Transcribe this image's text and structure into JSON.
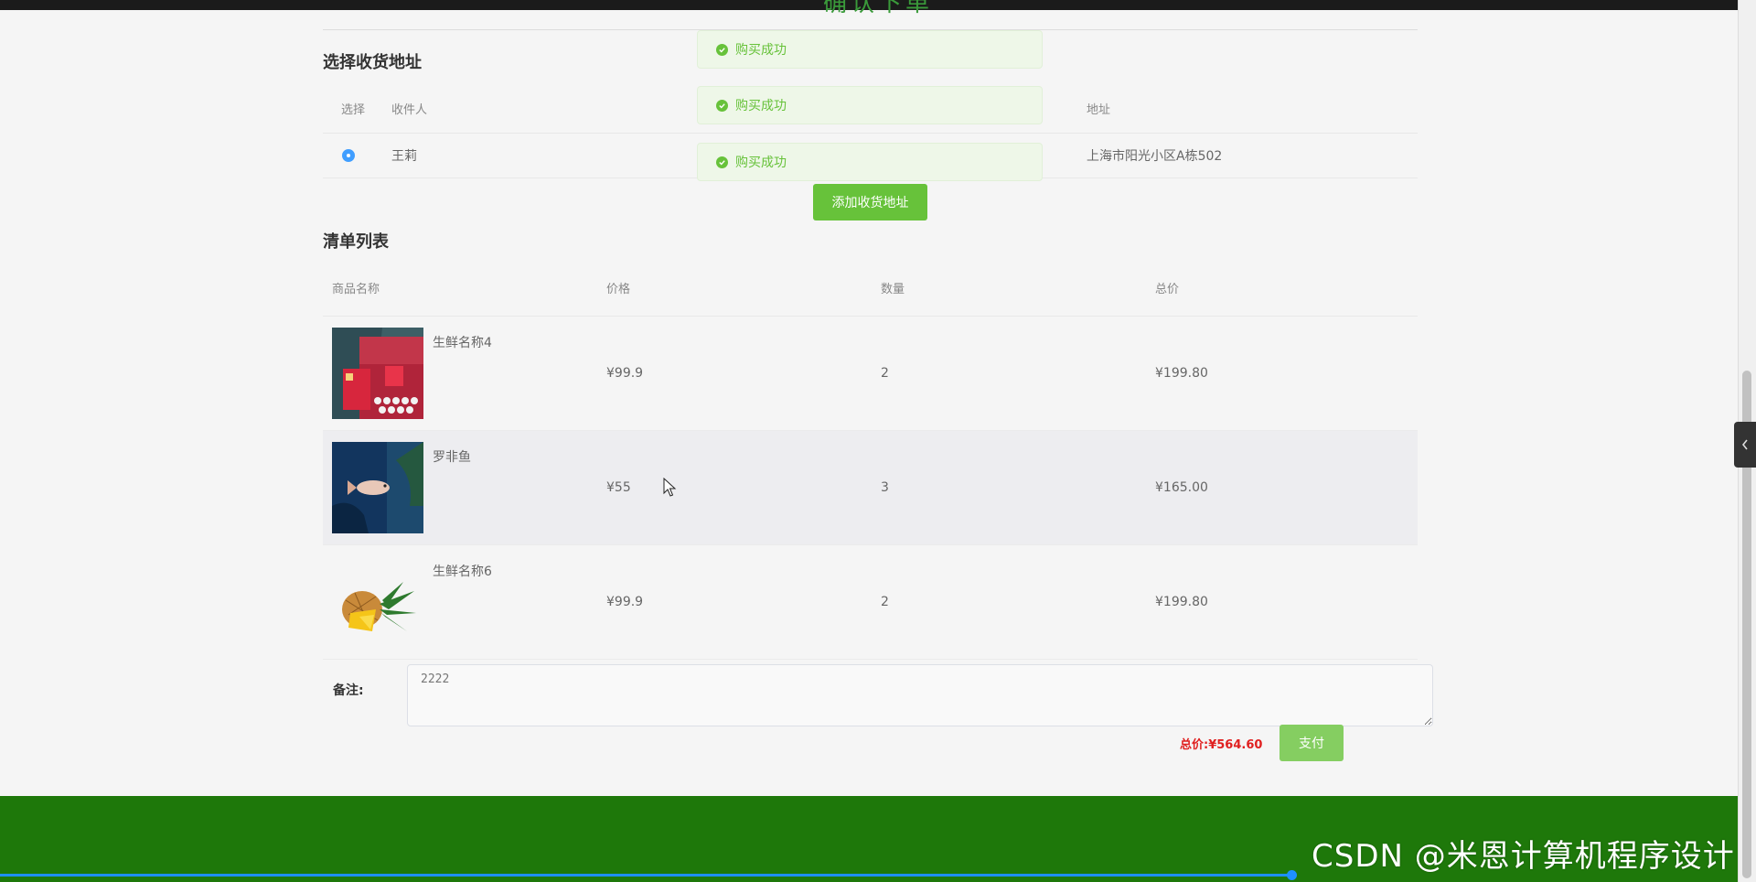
{
  "header": {
    "partial_title": "确认下单"
  },
  "address": {
    "title": "选择收货地址",
    "columns": [
      "选择",
      "收件人",
      "地址"
    ],
    "rows": [
      {
        "recipient": "王莉",
        "address": "上海市阳光小区A栋502",
        "selected": true
      }
    ],
    "add_button": "添加收货地址"
  },
  "list": {
    "title": "清单列表",
    "columns": [
      "商品名称",
      "价格",
      "数量",
      "总价"
    ],
    "rows": [
      {
        "name": "生鲜名称4",
        "price": "¥99.9",
        "qty": "2",
        "subtotal": "¥199.80",
        "image": "gift-box-image"
      },
      {
        "name": "罗非鱼",
        "price": "¥55",
        "qty": "3",
        "subtotal": "¥165.00",
        "image": "fish-image"
      },
      {
        "name": "生鲜名称6",
        "price": "¥99.9",
        "qty": "2",
        "subtotal": "¥199.80",
        "image": "pineapple-image"
      }
    ]
  },
  "remark": {
    "label": "备注:",
    "value": "2222"
  },
  "summary": {
    "total_label": "总价:",
    "total_value": "¥564.60",
    "pay_button": "支付"
  },
  "toasts": [
    "购买成功",
    "购买成功",
    "购买成功"
  ],
  "watermark": "CSDN @米恩计算机程序设计",
  "colors": {
    "primary_green": "#67c23a",
    "footer_green": "#1e780a",
    "total_red": "#e02020",
    "radio_blue": "#409eff"
  }
}
